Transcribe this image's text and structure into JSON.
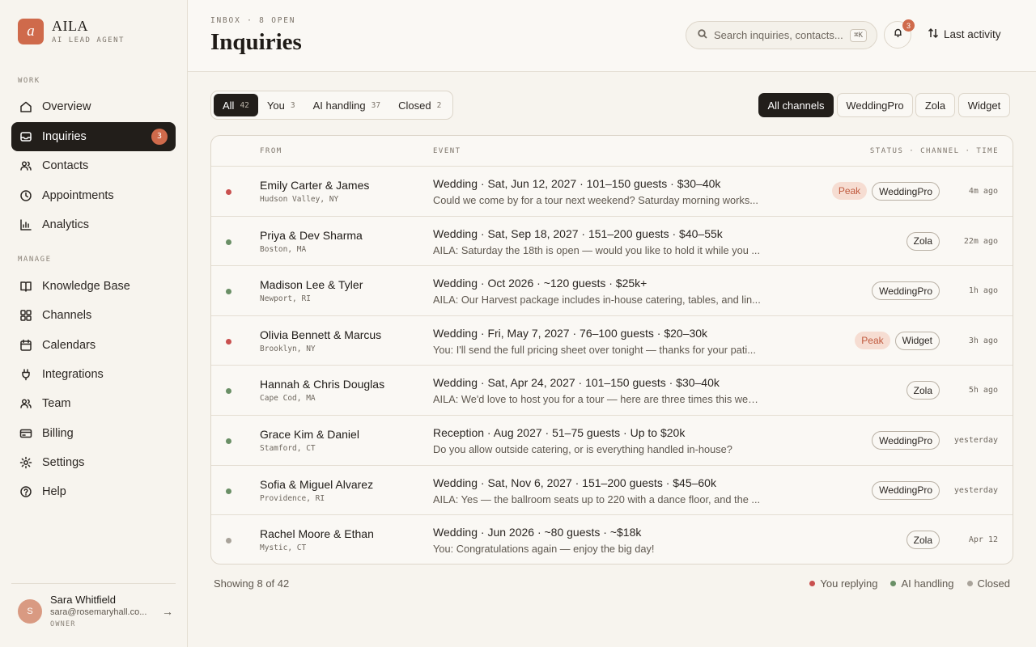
{
  "brand": {
    "logo_letter": "a",
    "name": "AILA",
    "subtitle": "AI LEAD AGENT"
  },
  "sidebar": {
    "sections": [
      {
        "label": "WORK"
      },
      {
        "label": "MANAGE"
      }
    ],
    "work_items": [
      {
        "label": "Overview",
        "icon": "home-icon"
      },
      {
        "label": "Inquiries",
        "icon": "inbox-icon",
        "badge": "3",
        "active": true
      },
      {
        "label": "Contacts",
        "icon": "users-icon"
      },
      {
        "label": "Appointments",
        "icon": "clock-icon"
      },
      {
        "label": "Analytics",
        "icon": "bar-chart-icon"
      }
    ],
    "manage_items": [
      {
        "label": "Knowledge Base",
        "icon": "book-icon"
      },
      {
        "label": "Channels",
        "icon": "grid-icon"
      },
      {
        "label": "Calendars",
        "icon": "calendar-icon"
      },
      {
        "label": "Integrations",
        "icon": "plug-icon"
      },
      {
        "label": "Team",
        "icon": "team-icon"
      },
      {
        "label": "Billing",
        "icon": "card-icon"
      },
      {
        "label": "Settings",
        "icon": "gear-icon"
      },
      {
        "label": "Help",
        "icon": "help-icon"
      }
    ],
    "user": {
      "initial": "S",
      "name": "Sara Whitfield",
      "email": "sara@rosemaryhall.co...",
      "role": "OWNER"
    }
  },
  "header": {
    "breadcrumb": "INBOX · 8 OPEN",
    "title": "Inquiries",
    "search_placeholder": "Search inquiries, contacts...",
    "search_shortcut": "⌘K",
    "notification_count": "3",
    "sort_label": "Last activity"
  },
  "filters": {
    "segments": [
      {
        "label": "All",
        "count": "42",
        "active": true
      },
      {
        "label": "You",
        "count": "3"
      },
      {
        "label": "AI handling",
        "count": "37"
      },
      {
        "label": "Closed",
        "count": "2"
      }
    ],
    "channels": [
      {
        "label": "All channels",
        "active": true
      },
      {
        "label": "WeddingPro"
      },
      {
        "label": "Zola"
      },
      {
        "label": "Widget"
      }
    ]
  },
  "table": {
    "headers": {
      "from": "FROM",
      "event": "EVENT",
      "status": "STATUS · CHANNEL · TIME"
    },
    "rows": [
      {
        "status": "you",
        "name": "Emily Carter & James",
        "location": "Hudson Valley, NY",
        "event": "Wedding · Sat, Jun 12, 2027 · 101–150 guests · $30–40k",
        "preview": "Could we come by for a tour next weekend? Saturday morning works...",
        "peak": "Peak",
        "channel": "WeddingPro",
        "time": "4m ago"
      },
      {
        "status": "ai",
        "name": "Priya & Dev Sharma",
        "location": "Boston, MA",
        "event": "Wedding · Sat, Sep 18, 2027 · 151–200 guests · $40–55k",
        "preview": "AILA: Saturday the 18th is open — would you like to hold it while you ...",
        "peak": "",
        "channel": "Zola",
        "time": "22m ago"
      },
      {
        "status": "ai",
        "name": "Madison Lee & Tyler",
        "location": "Newport, RI",
        "event": "Wedding · Oct 2026 · ~120 guests · $25k+",
        "preview": "AILA: Our Harvest package includes in-house catering, tables, and lin...",
        "peak": "",
        "channel": "WeddingPro",
        "time": "1h ago"
      },
      {
        "status": "you",
        "name": "Olivia Bennett & Marcus",
        "location": "Brooklyn, NY",
        "event": "Wedding · Fri, May 7, 2027 · 76–100 guests · $20–30k",
        "preview": "You: I'll send the full pricing sheet over tonight — thanks for your pati...",
        "peak": "Peak",
        "channel": "Widget",
        "time": "3h ago"
      },
      {
        "status": "ai",
        "name": "Hannah & Chris Douglas",
        "location": "Cape Cod, MA",
        "event": "Wedding · Sat, Apr 24, 2027 · 101–150 guests · $30–40k",
        "preview": "AILA: We'd love to host you for a tour — here are three times this week.",
        "peak": "",
        "channel": "Zola",
        "time": "5h ago"
      },
      {
        "status": "ai",
        "name": "Grace Kim & Daniel",
        "location": "Stamford, CT",
        "event": "Reception · Aug 2027 · 51–75 guests · Up to $20k",
        "preview": "Do you allow outside catering, or is everything handled in-house?",
        "peak": "",
        "channel": "WeddingPro",
        "time": "yesterday"
      },
      {
        "status": "ai",
        "name": "Sofia & Miguel Alvarez",
        "location": "Providence, RI",
        "event": "Wedding · Sat, Nov 6, 2027 · 151–200 guests · $45–60k",
        "preview": "AILA: Yes — the ballroom seats up to 220 with a dance floor, and the ...",
        "peak": "",
        "channel": "WeddingPro",
        "time": "yesterday"
      },
      {
        "status": "closed",
        "name": "Rachel Moore & Ethan",
        "location": "Mystic, CT",
        "event": "Wedding · Jun 2026 · ~80 guests · ~$18k",
        "preview": "You: Congratulations again — enjoy the big day!",
        "peak": "",
        "channel": "Zola",
        "time": "Apr 12"
      }
    ]
  },
  "footer": {
    "count": "Showing 8 of 42",
    "legend": [
      {
        "key": "you",
        "label": "You replying"
      },
      {
        "key": "ai",
        "label": "AI handling"
      },
      {
        "key": "closed",
        "label": "Closed"
      }
    ]
  },
  "colors": {
    "you": "#c9504f",
    "ai": "#6a8f66",
    "closed": "#a9a39a",
    "accent": "#cf6a4b"
  }
}
